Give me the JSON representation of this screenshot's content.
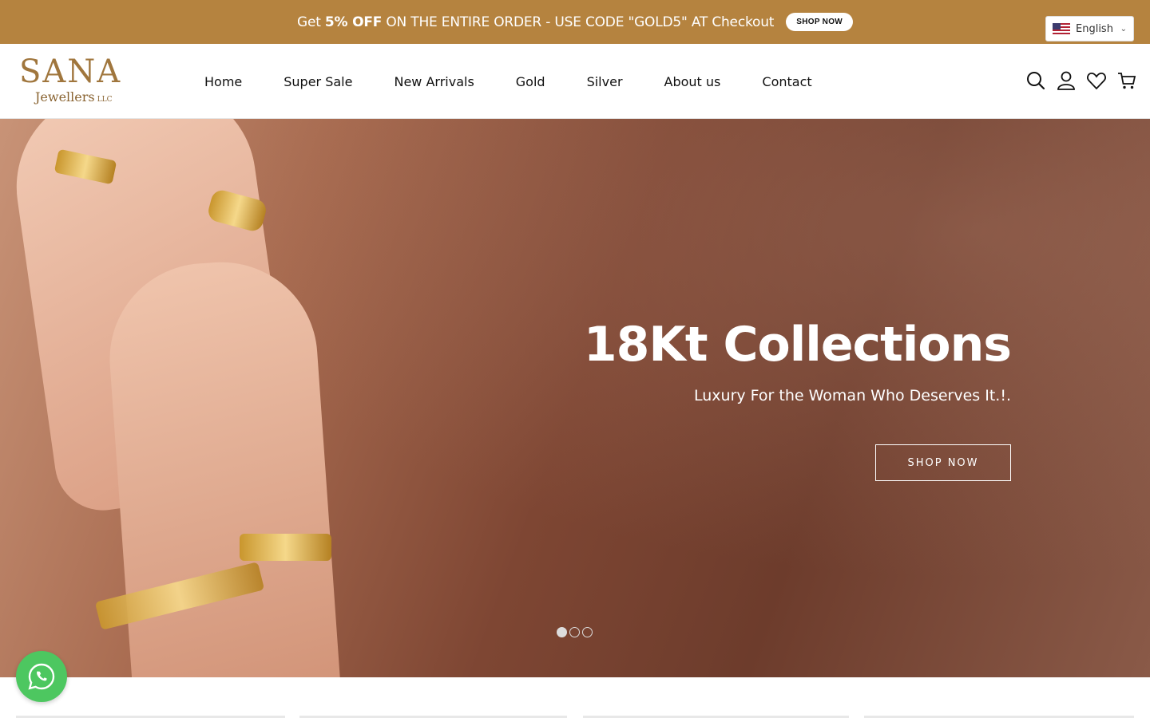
{
  "announcement": {
    "text_prefix": "Get",
    "text_bold": "5% OFF",
    "text_suffix": "ON THE ENTIRE ORDER - USE CODE \"GOLD5\" AT Checkout",
    "button_label": "SHOP NOW",
    "background": "#b5833f"
  },
  "language": {
    "selected": "English"
  },
  "logo": {
    "main": "SANA",
    "sub": "Jewellers",
    "suffix": "LLC"
  },
  "nav": {
    "items": [
      {
        "label": "Home"
      },
      {
        "label": "Super Sale"
      },
      {
        "label": "New Arrivals"
      },
      {
        "label": "Gold"
      },
      {
        "label": "Silver"
      },
      {
        "label": "About us"
      },
      {
        "label": "Contact"
      }
    ]
  },
  "header_icons": [
    "search-icon",
    "account-icon",
    "wishlist-icon",
    "cart-icon"
  ],
  "hero": {
    "title": "18Kt Collections",
    "subtitle": "Luxury For the Woman Who Deserves It.!.",
    "button_label": "SHOP NOW",
    "slide_count": 3,
    "active_slide": 1
  },
  "whatsapp": {
    "icon": "whatsapp-icon",
    "color": "#4dc760"
  }
}
